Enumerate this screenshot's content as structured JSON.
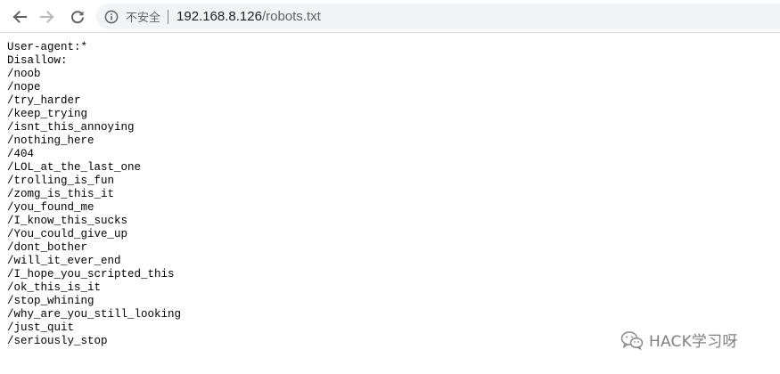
{
  "browser": {
    "security_label": "不安全",
    "url_host": "192.168.8.126",
    "url_path": "/robots.txt",
    "icons": {
      "back": "arrow-left-icon",
      "forward": "arrow-right-icon",
      "reload": "reload-icon",
      "info": "info-circle-icon"
    }
  },
  "document": {
    "lines": [
      "User-agent:*",
      "Disallow:",
      "/noob",
      "/nope",
      "/try_harder",
      "/keep_trying",
      "/isnt_this_annoying",
      "/nothing_here",
      "/404",
      "/LOL_at_the_last_one",
      "/trolling_is_fun",
      "/zomg_is_this_it",
      "/you_found_me",
      "/I_know_this_sucks",
      "/You_could_give_up",
      "/dont_bother",
      "/will_it_ever_end",
      "/I_hope_you_scripted_this",
      "/ok_this_is_it",
      "/stop_whining",
      "/why_are_you_still_looking",
      "/just_quit",
      "/seriously_stop"
    ]
  },
  "watermark": {
    "text": "HACK学习呀",
    "icon": "wechat-logo-icon"
  }
}
